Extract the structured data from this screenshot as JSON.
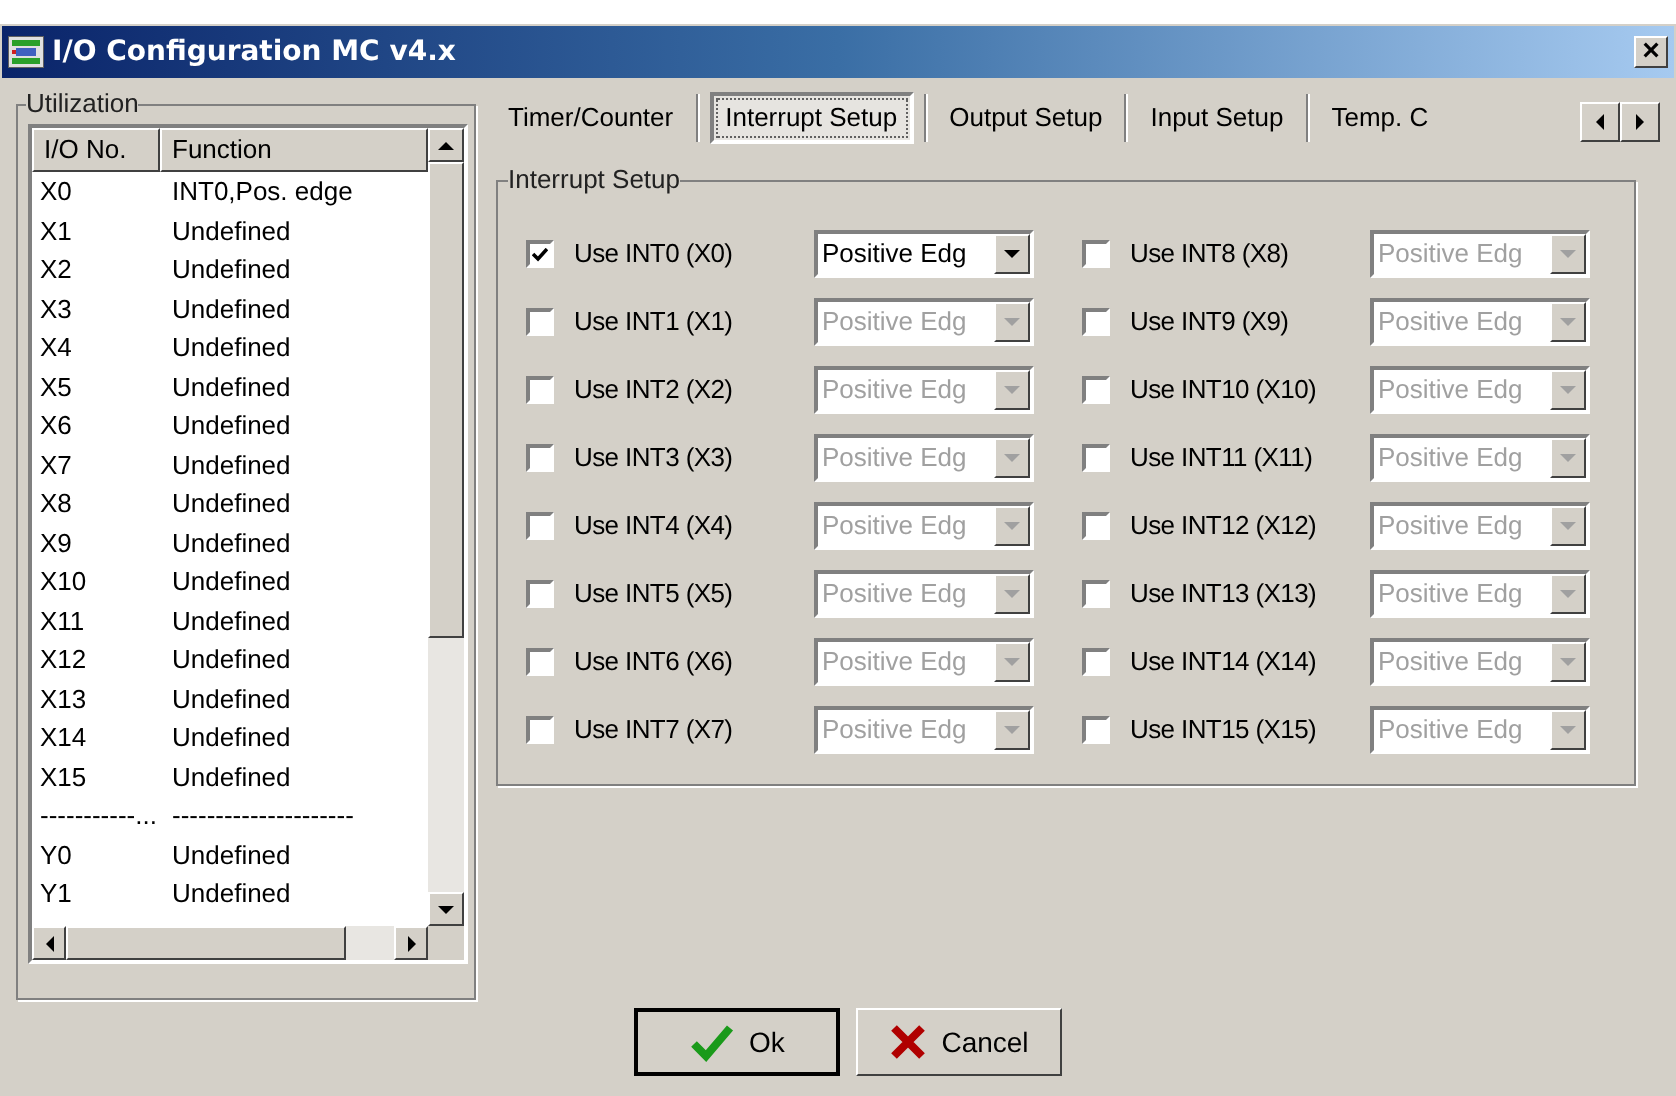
{
  "window": {
    "title": "I/O Configuration MC v4.x",
    "close": "×"
  },
  "utilization": {
    "title": "Utilization",
    "columns": [
      "I/O No.",
      "Function"
    ],
    "rows": [
      [
        "X0",
        "INT0,Pos. edge"
      ],
      [
        "X1",
        "Undefined"
      ],
      [
        "X2",
        "Undefined"
      ],
      [
        "X3",
        "Undefined"
      ],
      [
        "X4",
        "Undefined"
      ],
      [
        "X5",
        "Undefined"
      ],
      [
        "X6",
        "Undefined"
      ],
      [
        "X7",
        "Undefined"
      ],
      [
        "X8",
        "Undefined"
      ],
      [
        "X9",
        "Undefined"
      ],
      [
        "X10",
        "Undefined"
      ],
      [
        "X11",
        "Undefined"
      ],
      [
        "X12",
        "Undefined"
      ],
      [
        "X13",
        "Undefined"
      ],
      [
        "X14",
        "Undefined"
      ],
      [
        "X15",
        "Undefined"
      ],
      [
        "-----------...",
        "---------------------"
      ],
      [
        "Y0",
        "Undefined"
      ],
      [
        "Y1",
        "Undefined"
      ]
    ]
  },
  "tabs": [
    {
      "label": "Timer/Counter",
      "selected": false
    },
    {
      "label": "Interrupt Setup",
      "selected": true
    },
    {
      "label": "Output Setup",
      "selected": false
    },
    {
      "label": "Input Setup",
      "selected": false
    },
    {
      "label": "Temp. C",
      "selected": false
    }
  ],
  "interrupt_setup": {
    "title": "Interrupt Setup",
    "items": [
      {
        "label": "Use INT0 (X0)",
        "checked": true,
        "value": "Positive Edg",
        "disabled": false
      },
      {
        "label": "Use INT1 (X1)",
        "checked": false,
        "value": "Positive Edg",
        "disabled": true
      },
      {
        "label": "Use INT2 (X2)",
        "checked": false,
        "value": "Positive Edg",
        "disabled": true
      },
      {
        "label": "Use INT3 (X3)",
        "checked": false,
        "value": "Positive Edg",
        "disabled": true
      },
      {
        "label": "Use INT4 (X4)",
        "checked": false,
        "value": "Positive Edg",
        "disabled": true
      },
      {
        "label": "Use INT5 (X5)",
        "checked": false,
        "value": "Positive Edg",
        "disabled": true
      },
      {
        "label": "Use INT6 (X6)",
        "checked": false,
        "value": "Positive Edg",
        "disabled": true
      },
      {
        "label": "Use INT7 (X7)",
        "checked": false,
        "value": "Positive Edg",
        "disabled": true
      },
      {
        "label": "Use INT8 (X8)",
        "checked": false,
        "value": "Positive Edg",
        "disabled": true
      },
      {
        "label": "Use INT9 (X9)",
        "checked": false,
        "value": "Positive Edg",
        "disabled": true
      },
      {
        "label": "Use INT10 (X10)",
        "checked": false,
        "value": "Positive Edg",
        "disabled": true
      },
      {
        "label": "Use INT11 (X11)",
        "checked": false,
        "value": "Positive Edg",
        "disabled": true
      },
      {
        "label": "Use INT12 (X12)",
        "checked": false,
        "value": "Positive Edg",
        "disabled": true
      },
      {
        "label": "Use INT13 (X13)",
        "checked": false,
        "value": "Positive Edg",
        "disabled": true
      },
      {
        "label": "Use INT14 (X14)",
        "checked": false,
        "value": "Positive Edg",
        "disabled": true
      },
      {
        "label": "Use INT15 (X15)",
        "checked": false,
        "value": "Positive Edg",
        "disabled": true
      }
    ]
  },
  "buttons": [
    {
      "label": "Ok",
      "kind": "ok"
    },
    {
      "label": "Cancel",
      "kind": "cancel"
    }
  ]
}
